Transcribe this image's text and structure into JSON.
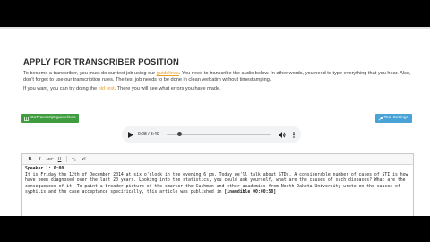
{
  "page": {
    "title": "APPLY FOR TRANSCRIBER POSITION",
    "intro": {
      "before": "To become a transcriber, you must do our test job using our ",
      "link": "guidelines",
      "after": ". You need to transcribe the audio below. In other words, you need to type everything that you hear. Also, don't forget to use our transcription rules. The test job needs to be done in clean verbatim without timestamping."
    },
    "try": {
      "before": "If you want, you can try doing the ",
      "link": "old test",
      "after": ". There you will see what errors you have made."
    }
  },
  "buttons": {
    "guidelines": "GoTranscript guidelines",
    "settings": "Tool Settings"
  },
  "player": {
    "current": "0:28",
    "duration": "3:40",
    "time_text": "0:28 / 3:40",
    "progress": 0.127
  },
  "toolbar": {
    "bold": "B",
    "italic": "I",
    "underline": "U",
    "caps": "ABC",
    "sub": "x₂",
    "sup": "x²"
  },
  "editor": {
    "speaker": "Speaker 1: 0:00",
    "text": "It is Friday the 12th of December 2014 at six o'clock in the evening 6 pm. Today we'll talk about STDs. A considerable number of cases of STI is how have been diagnosed over the last 20 years. Looking into the statistics, you could ask yourself, what are the causes of such diseases? What are the consequences of it. To paint a broader picture of the smarter the Cushman and other academics from North Dakota University wrote on the causes of syphilis and the case acceptance specifically, this article was published in",
    "tag": "[inaudible 00:00:58]"
  },
  "colors": {
    "link": "#e8a024",
    "guidelines_button": "#3f9d3f",
    "settings_button": "#4aa3d6"
  }
}
